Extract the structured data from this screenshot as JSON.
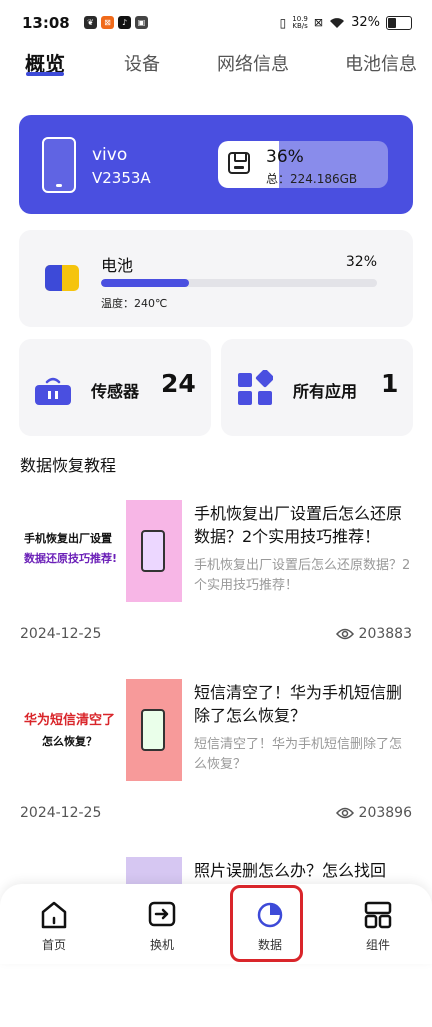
{
  "status_bar": {
    "time": "13:08",
    "app_icons": [
      "leaf-icon",
      "mi-store-icon",
      "tiktok-icon",
      "app-icon"
    ],
    "net_speed_value": "10.9",
    "net_speed_unit": "KB/s",
    "battery_percent": "32%",
    "battery_level": 0.32
  },
  "tabs": [
    {
      "label": "概览",
      "active": true
    },
    {
      "label": "设备",
      "active": false
    },
    {
      "label": "网络信息",
      "active": false
    },
    {
      "label": "电池信息",
      "active": false
    }
  ],
  "device": {
    "brand": "vivo",
    "model": "V2353A",
    "storage_percent": "36%",
    "storage_fraction": 0.36,
    "storage_total": "总：224.186GB"
  },
  "battery": {
    "title": "电池",
    "percent": "32%",
    "level": 0.32,
    "temperature": "温度：240℃"
  },
  "sensor": {
    "label": "传感器",
    "count": "24"
  },
  "apps": {
    "label": "所有应用",
    "count": "1"
  },
  "section_title": "数据恢复教程",
  "articles": [
    {
      "title": "手机恢复出厂设置后怎么还原数据？2个实用技巧推荐！",
      "summary": "手机恢复出厂设置后怎么还原数据？2个实用技巧推荐！",
      "date": "2024-12-25",
      "views": "203883",
      "thumb_line1": "手机恢复出厂设置",
      "thumb_line2": "数据还原技巧推荐!",
      "thumb_color": "#f7b6e6",
      "thumb_text_color": "#6b20b8"
    },
    {
      "title": "短信清空了！华为手机短信删除了怎么恢复？",
      "summary": "短信清空了！华为手机短信删除了怎么恢复？",
      "date": "2024-12-25",
      "views": "203896",
      "thumb_line1": "华为短信清空了",
      "thumb_line2": "怎么恢复？",
      "thumb_color": "#f79a9a",
      "thumb_text_color": "#d9252a"
    },
    {
      "title": "照片误删怎么办？怎么找回",
      "thumb_color": "#d6c7f2"
    }
  ],
  "bottom_nav": [
    {
      "label": "首页",
      "icon": "home-icon"
    },
    {
      "label": "换机",
      "icon": "switch-phone-icon"
    },
    {
      "label": "数据",
      "icon": "data-pie-icon",
      "active": true
    },
    {
      "label": "组件",
      "icon": "widgets-icon"
    }
  ],
  "colors": {
    "accent": "#4a4fe0",
    "battery_yellow": "#f5c40e",
    "highlight": "#d9252a"
  }
}
